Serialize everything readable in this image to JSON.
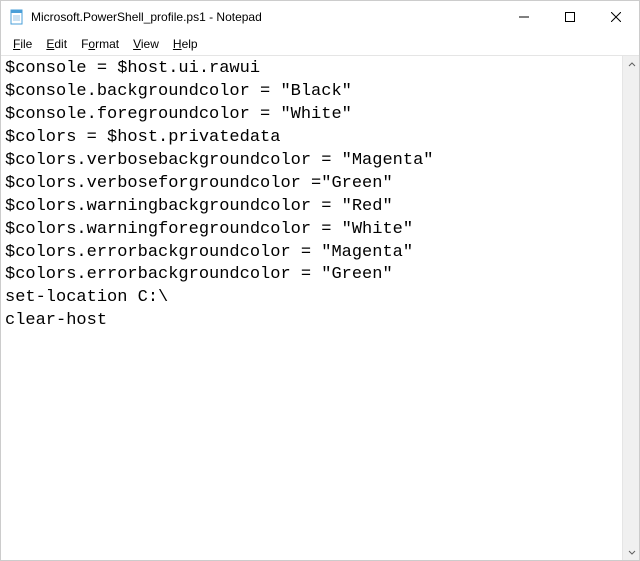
{
  "window": {
    "title": "Microsoft.PowerShell_profile.ps1 - Notepad"
  },
  "menubar": {
    "items": [
      {
        "key": "F",
        "rest": "ile"
      },
      {
        "key": "E",
        "rest": "dit"
      },
      {
        "key": "",
        "rest": "F",
        "key2": "o",
        "rest2": "rmat"
      },
      {
        "key": "V",
        "rest": "iew"
      },
      {
        "key": "H",
        "rest": "elp"
      }
    ]
  },
  "editor": {
    "content": "$console = $host.ui.rawui\n$console.backgroundcolor = \"Black\"\n$console.foregroundcolor = \"White\"\n$colors = $host.privatedata\n$colors.verbosebackgroundcolor = \"Magenta\"\n$colors.verboseforgroundcolor =\"Green\"\n$colors.warningbackgroundcolor = \"Red\"\n$colors.warningforegroundcolor = \"White\"\n$colors.errorbackgroundcolor = \"Magenta\"\n$colors.errorbackgroundcolor = \"Green\"\nset-location C:\\\nclear-host"
  }
}
